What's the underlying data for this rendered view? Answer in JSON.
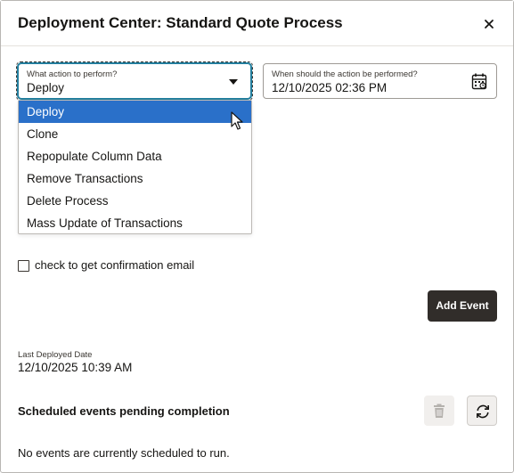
{
  "dialog": {
    "title": "Deployment Center: Standard Quote Process"
  },
  "action_field": {
    "label": "What action to perform?",
    "value": "Deploy",
    "options": [
      "Deploy",
      "Clone",
      "Repopulate Column Data",
      "Remove Transactions",
      "Delete Process",
      "Mass Update of Transactions"
    ],
    "selected_index": 0
  },
  "date_field": {
    "label": "When should the action be performed?",
    "value": "12/10/2025 02:36 PM"
  },
  "confirmation": {
    "label": "check to get confirmation email",
    "checked": false
  },
  "add_event_label": "Add Event",
  "last_deployed": {
    "label": "Last Deployed Date",
    "value": "12/10/2025 10:39 AM"
  },
  "scheduled": {
    "title": "Scheduled events pending completion",
    "empty_message": "No events are currently scheduled to run."
  },
  "colors": {
    "accent_focus": "#227e9e",
    "selected_option": "#2a70c9",
    "primary_button": "#312d2a"
  },
  "icons": {
    "close": "close-icon",
    "calendar": "calendar-icon",
    "delete": "trash-icon",
    "refresh": "refresh-icon",
    "dropdown": "caret-down-icon"
  }
}
